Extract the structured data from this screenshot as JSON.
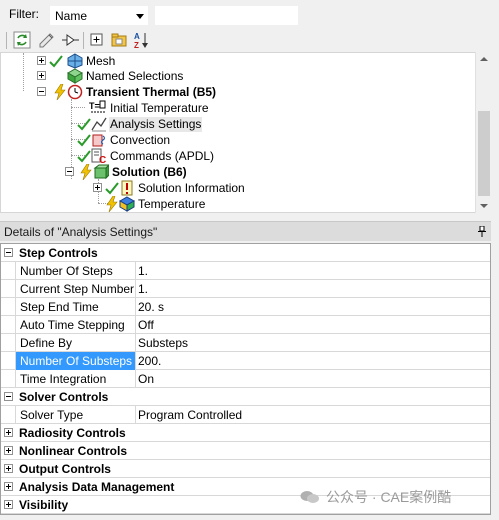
{
  "filter": {
    "label": "Filter:",
    "selected": "Name",
    "text_value": ""
  },
  "toolbar": {
    "buttons": [
      "refresh-icon",
      "edit-icon",
      "flag-icon",
      "expand-all-icon",
      "folder-icon",
      "sort-az-icon"
    ]
  },
  "tree": {
    "items": [
      {
        "label": "Mesh",
        "icon": "mesh-icon",
        "bold": false
      },
      {
        "label": "Named Selections",
        "icon": "named-selections-icon",
        "bold": false
      },
      {
        "label": "Transient Thermal (B5)",
        "icon": "transient-thermal-icon",
        "bold": true
      },
      {
        "label": "Initial Temperature",
        "icon": "initial-temperature-icon",
        "bold": false
      },
      {
        "label": "Analysis Settings",
        "icon": "analysis-settings-icon",
        "bold": false,
        "selected": true
      },
      {
        "label": "Convection",
        "icon": "convection-icon",
        "bold": false
      },
      {
        "label": "Commands (APDL)",
        "icon": "commands-icon",
        "bold": false
      },
      {
        "label": "Solution (B6)",
        "icon": "solution-icon",
        "bold": true
      },
      {
        "label": "Solution Information",
        "icon": "solution-information-icon",
        "bold": false
      },
      {
        "label": "Temperature",
        "icon": "temperature-result-icon",
        "bold": false
      }
    ]
  },
  "details": {
    "title": "Details of \"Analysis Settings\"",
    "groups": [
      {
        "label": "Step Controls",
        "expanded": true
      },
      {
        "label": "Solver Controls",
        "expanded": true
      },
      {
        "label": "Radiosity Controls",
        "expanded": false
      },
      {
        "label": "Nonlinear Controls",
        "expanded": false
      },
      {
        "label": "Output Controls",
        "expanded": false
      },
      {
        "label": "Analysis Data Management",
        "expanded": false
      },
      {
        "label": "Visibility",
        "expanded": false
      }
    ],
    "step_controls": [
      {
        "name": "Number Of Steps",
        "value": "1."
      },
      {
        "name": "Current Step Number",
        "value": "1."
      },
      {
        "name": "Step End Time",
        "value": "20. s"
      },
      {
        "name": "Auto Time Stepping",
        "value": "Off"
      },
      {
        "name": "Define By",
        "value": "Substeps"
      },
      {
        "name": "Number Of Substeps",
        "value": "200.",
        "highlighted": true
      },
      {
        "name": "Time Integration",
        "value": "On"
      }
    ],
    "solver_controls": [
      {
        "name": "Solver Type",
        "value": "Program Controlled"
      }
    ]
  },
  "watermark": {
    "text": "公众号 · CAE案例酷"
  },
  "colors": {
    "selection": "#3399ff",
    "check": "#2a9a2a",
    "panel_bg": "#f0f0f0"
  }
}
